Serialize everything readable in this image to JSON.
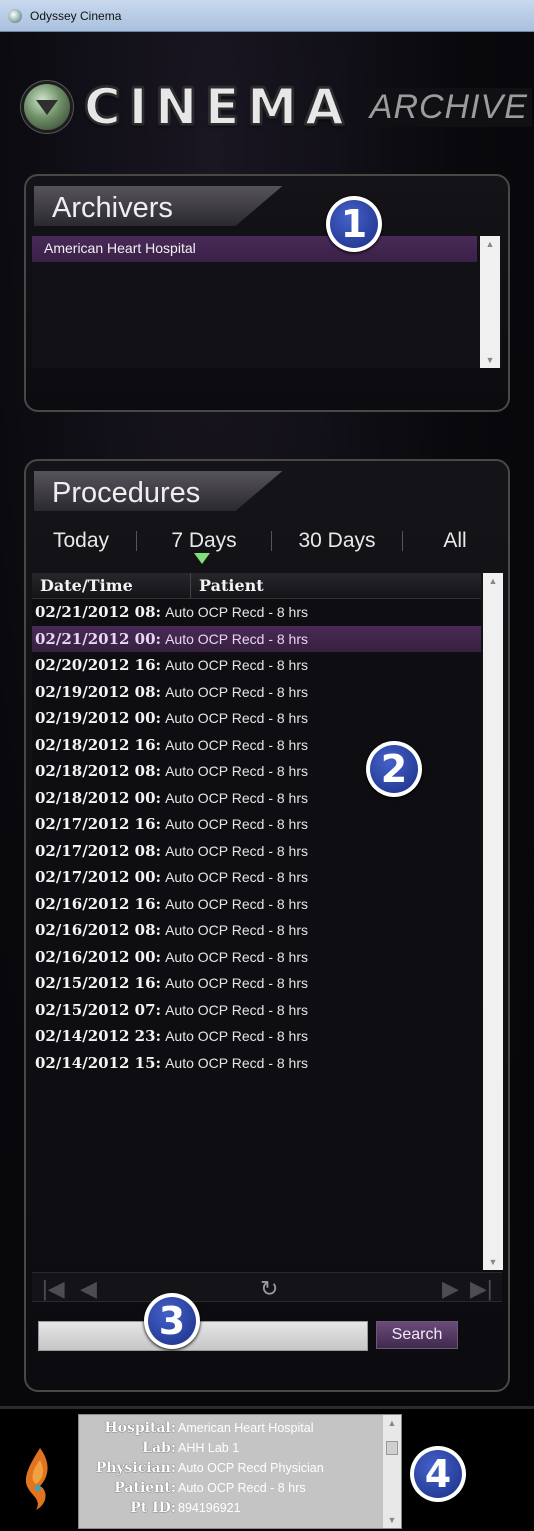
{
  "window": {
    "title": "Odyssey Cinema"
  },
  "logo": {
    "cinema": "CINEMA",
    "archive": "ARCHIVE"
  },
  "archivers": {
    "heading": "Archivers",
    "items": [
      {
        "label": "American Heart Hospital",
        "selected": true
      }
    ]
  },
  "procedures": {
    "heading": "Procedures",
    "filters": [
      "Today",
      "7 Days",
      "30 Days",
      "All"
    ],
    "active_filter": "7 Days",
    "columns": [
      "Date/Time",
      "Patient"
    ],
    "rows": [
      {
        "datetime": "02/21/2012 08:",
        "patient": "Auto OCP Recd - 8 hrs"
      },
      {
        "datetime": "02/21/2012 00:",
        "patient": "Auto OCP Recd - 8 hrs"
      },
      {
        "datetime": "02/20/2012 16:",
        "patient": "Auto OCP Recd - 8 hrs"
      },
      {
        "datetime": "02/19/2012 08:",
        "patient": "Auto OCP Recd - 8 hrs"
      },
      {
        "datetime": "02/19/2012 00:",
        "patient": "Auto OCP Recd - 8 hrs"
      },
      {
        "datetime": "02/18/2012 16:",
        "patient": "Auto OCP Recd - 8 hrs"
      },
      {
        "datetime": "02/18/2012 08:",
        "patient": "Auto OCP Recd - 8 hrs"
      },
      {
        "datetime": "02/18/2012 00:",
        "patient": "Auto OCP Recd - 8 hrs"
      },
      {
        "datetime": "02/17/2012 16:",
        "patient": "Auto OCP Recd - 8 hrs"
      },
      {
        "datetime": "02/17/2012 08:",
        "patient": "Auto OCP Recd - 8 hrs"
      },
      {
        "datetime": "02/17/2012 00:",
        "patient": "Auto OCP Recd - 8 hrs"
      },
      {
        "datetime": "02/16/2012 16:",
        "patient": "Auto OCP Recd - 8 hrs"
      },
      {
        "datetime": "02/16/2012 08:",
        "patient": "Auto OCP Recd - 8 hrs"
      },
      {
        "datetime": "02/16/2012 00:",
        "patient": "Auto OCP Recd - 8 hrs"
      },
      {
        "datetime": "02/15/2012 16:",
        "patient": "Auto OCP Recd - 8 hrs"
      },
      {
        "datetime": "02/15/2012 07:",
        "patient": "Auto OCP Recd - 8 hrs"
      },
      {
        "datetime": "02/14/2012 23:",
        "patient": "Auto OCP Recd - 8 hrs"
      },
      {
        "datetime": "02/14/2012 15:",
        "patient": "Auto OCP Recd - 8 hrs"
      }
    ],
    "selected_row": 1
  },
  "search": {
    "value": "",
    "button_label": "Search"
  },
  "details": [
    {
      "key": "Hospital:",
      "value": "American Heart Hospital"
    },
    {
      "key": "Lab:",
      "value": "AHH Lab 1"
    },
    {
      "key": "Physician:",
      "value": "Auto OCP Recd Physician"
    },
    {
      "key": "Patient:",
      "value": "Auto OCP Recd - 8 hrs"
    },
    {
      "key": "Pt ID:",
      "value": "894196921"
    }
  ],
  "callouts": [
    "1",
    "2",
    "3",
    "4"
  ],
  "colors": {
    "accent_purple": "#4a2a58",
    "filter_indicator": "#7fe07a",
    "callout_blue": "#1a2f86"
  }
}
